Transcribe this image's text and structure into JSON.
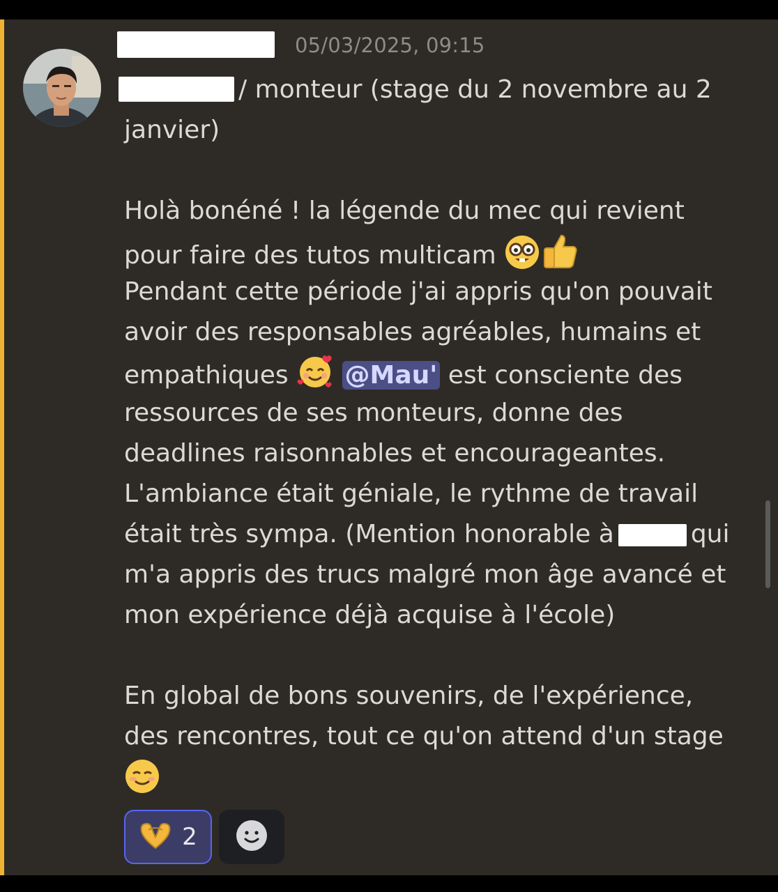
{
  "message": {
    "timestamp": "05/03/2025, 09:15",
    "lines": [
      "/ monteur (stage du 2 novembre au 2",
      "janvier)",
      "Holà bonéné ! la légende du mec qui revient",
      "pour faire des tutos multicam",
      "Pendant cette période j'ai appris qu'on pouvait",
      "avoir des responsables agréables, humains et",
      "empathiques",
      "est consciente des",
      "ressources de ses monteurs, donne des",
      "deadlines raisonnables et encourageantes.",
      "L'ambiance était géniale, le rythme de travail",
      "était très sympa. (Mention honorable à",
      "qui",
      "m'a appris des trucs malgré mon âge avancé et",
      "mon expérience déjà acquise à l'école)",
      "En global de bons souvenirs, de l'expérience,",
      "des rencontres, tout ce qu'on attend d'un stage"
    ],
    "mention": "@Mau'",
    "emojis": {
      "nerd": "nerd-face-icon",
      "thumbs": "thumbs-up-icon",
      "hearts": "smiling-face-with-hearts-icon",
      "smile": "smiling-face-icon"
    }
  },
  "reactions": [
    {
      "icon": "heart-hands-icon",
      "count": "2",
      "active": true
    }
  ],
  "add_reaction_icon": "add-reaction-smiley-icon",
  "colors": {
    "background": "#2e2b26",
    "highlight": "#f0b232",
    "mention_bg": "#4b4f86",
    "reaction_border": "#5865f2"
  }
}
